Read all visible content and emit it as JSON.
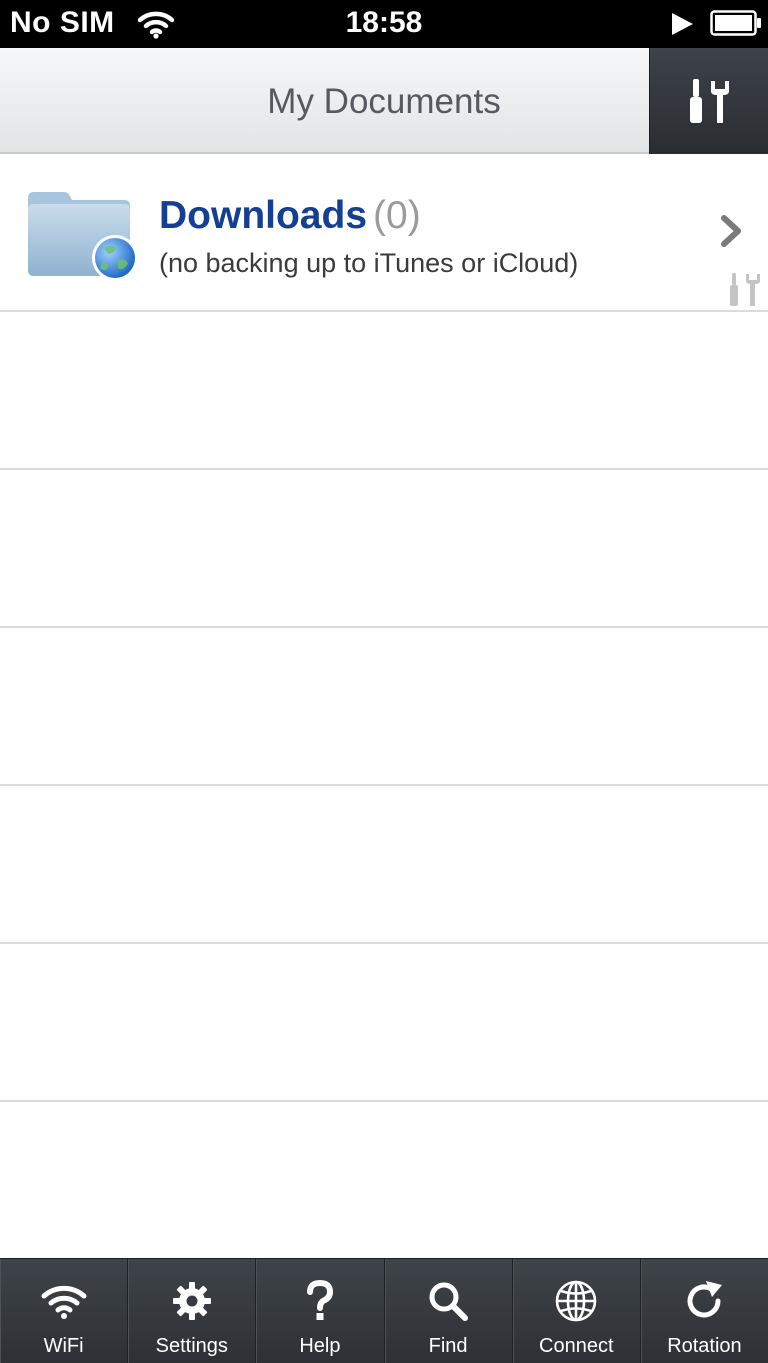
{
  "status_bar": {
    "carrier": "No SIM",
    "time": "18:58"
  },
  "nav": {
    "title": "My Documents",
    "tools_icon": "tools-icon"
  },
  "rows": [
    {
      "title": "Downloads",
      "count": "(0)",
      "subtitle": "(no backing up to iTunes or iCloud)",
      "icon": "folder-globe-icon"
    }
  ],
  "tabs": [
    {
      "label": "WiFi",
      "icon": "wifi-icon"
    },
    {
      "label": "Settings",
      "icon": "gear-icon"
    },
    {
      "label": "Help",
      "icon": "question-icon"
    },
    {
      "label": "Find",
      "icon": "search-icon"
    },
    {
      "label": "Connect",
      "icon": "globe-icon"
    },
    {
      "label": "Rotation",
      "icon": "rotation-icon"
    }
  ],
  "colors": {
    "title_blue": "#143f93",
    "tab_bar": "#34383c",
    "nav_bar": "#eceef0"
  }
}
